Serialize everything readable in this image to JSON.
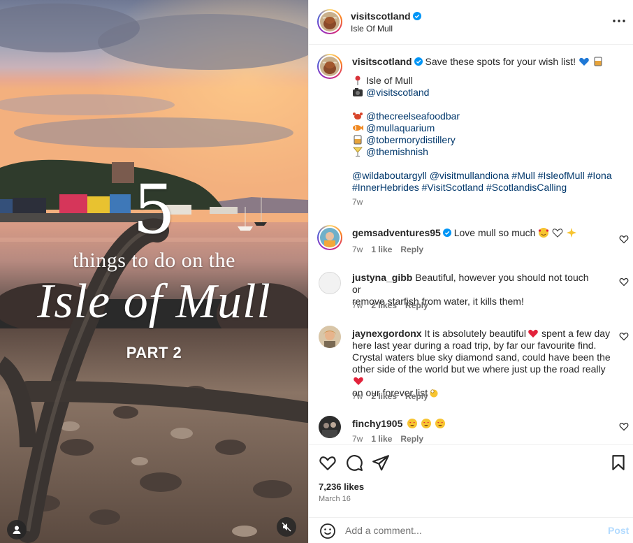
{
  "media": {
    "overlay_number": "5",
    "overlay_line1": "things to do on the",
    "overlay_line2": "Isle of Mull",
    "overlay_part": "PART 2",
    "tag_icon": "user-tag-icon",
    "mute_icon": "speaker-muted-icon"
  },
  "header": {
    "username": "visitscotland",
    "location": "Isle Of Mull",
    "more_icon": "more-horizontal-icon"
  },
  "caption": {
    "username": "visitscotland",
    "text": "Save these spots for your wish list!",
    "lines": [
      {
        "icon": "pushpin-icon",
        "text": "Isle of Mull",
        "link": false
      },
      {
        "icon": "camera-icon",
        "text": "@visitscotland",
        "link": true
      },
      {
        "icon": "",
        "text": "",
        "link": false
      },
      {
        "icon": "crab-icon",
        "text": "@thecreelseafoodbar",
        "link": true
      },
      {
        "icon": "fish-icon",
        "text": "@mullaquarium",
        "link": true
      },
      {
        "icon": "whisky-glass-icon",
        "text": "@tobermorydistillery",
        "link": true
      },
      {
        "icon": "cocktail-glass-icon",
        "text": "@themishnish",
        "link": true
      }
    ],
    "hashtags_line1": "@wildaboutargyll @visitmullandiona #Mull #IsleofMull #Iona",
    "hashtags_line2": "#InnerHebrides #VisitScotland #ScotlandisCalling",
    "time": "7w"
  },
  "comments": [
    {
      "username": "gemsadventures95",
      "verified": true,
      "text": "Love mull so much",
      "time": "7w",
      "likes": "1 like",
      "reply": "Reply"
    },
    {
      "username": "justyna_gibb",
      "verified": false,
      "text_lines": [
        "Beautiful, however you should not touch or",
        "remove starfish from water, it kills them!"
      ],
      "time": "7w",
      "likes": "2 likes",
      "reply": "Reply"
    },
    {
      "username": "jaynexgordonx",
      "verified": false,
      "text_lines": [
        "It is absolutely beautiful",
        "spent a few day",
        "here last year during a road trip, by far our favourite find.",
        "Crystal waters blue sky diamond sand, could have been the",
        "other side of the world but we where just up the road really",
        "on our forever list"
      ],
      "time": "7w",
      "likes": "2 likes",
      "reply": "Reply"
    },
    {
      "username": "finchy1905",
      "verified": false,
      "text": "",
      "time": "7w",
      "likes": "1 like",
      "reply": "Reply"
    }
  ],
  "actions": {
    "likes": "7,236 likes",
    "date": "March 16"
  },
  "add_comment": {
    "placeholder": "Add a comment...",
    "post_label": "Post"
  },
  "colors": {
    "link": "#00376b",
    "verified": "#0095f6",
    "muted": "#737373",
    "post_disabled": "#b3dbff"
  }
}
